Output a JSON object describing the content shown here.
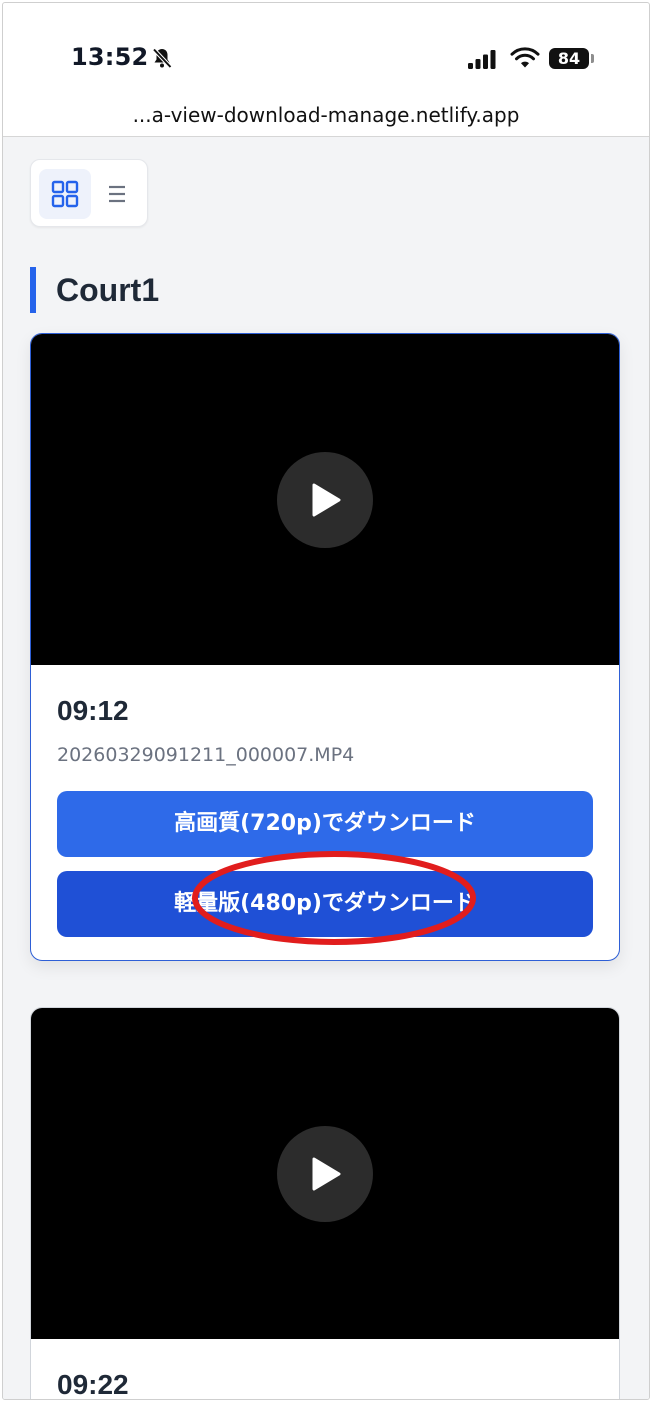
{
  "status_bar": {
    "time": "13:52",
    "battery_level": "84",
    "icons": [
      "bell-slash-icon",
      "cellular-signal-icon",
      "wifi-icon",
      "battery-icon"
    ]
  },
  "browser": {
    "url": "...a-view-download-manage.netlify.app"
  },
  "view_toggle": {
    "options": [
      "grid-view-icon",
      "list-view-icon"
    ],
    "selected": "grid"
  },
  "section": {
    "title": "Court1"
  },
  "videos": [
    {
      "time": "09:12",
      "filename": "20260329091211_000007.MP4",
      "download_hq_label": "高画質(720p)でダウンロード",
      "download_lite_label": "軽量版(480p)でダウンロード"
    },
    {
      "time": "09:22"
    }
  ],
  "colors": {
    "accent": "#2563eb",
    "button_hq": "#2e6ae9",
    "button_lite": "#1f50d6",
    "annotation": "#e11d1d",
    "page_bg": "#f3f4f6"
  }
}
